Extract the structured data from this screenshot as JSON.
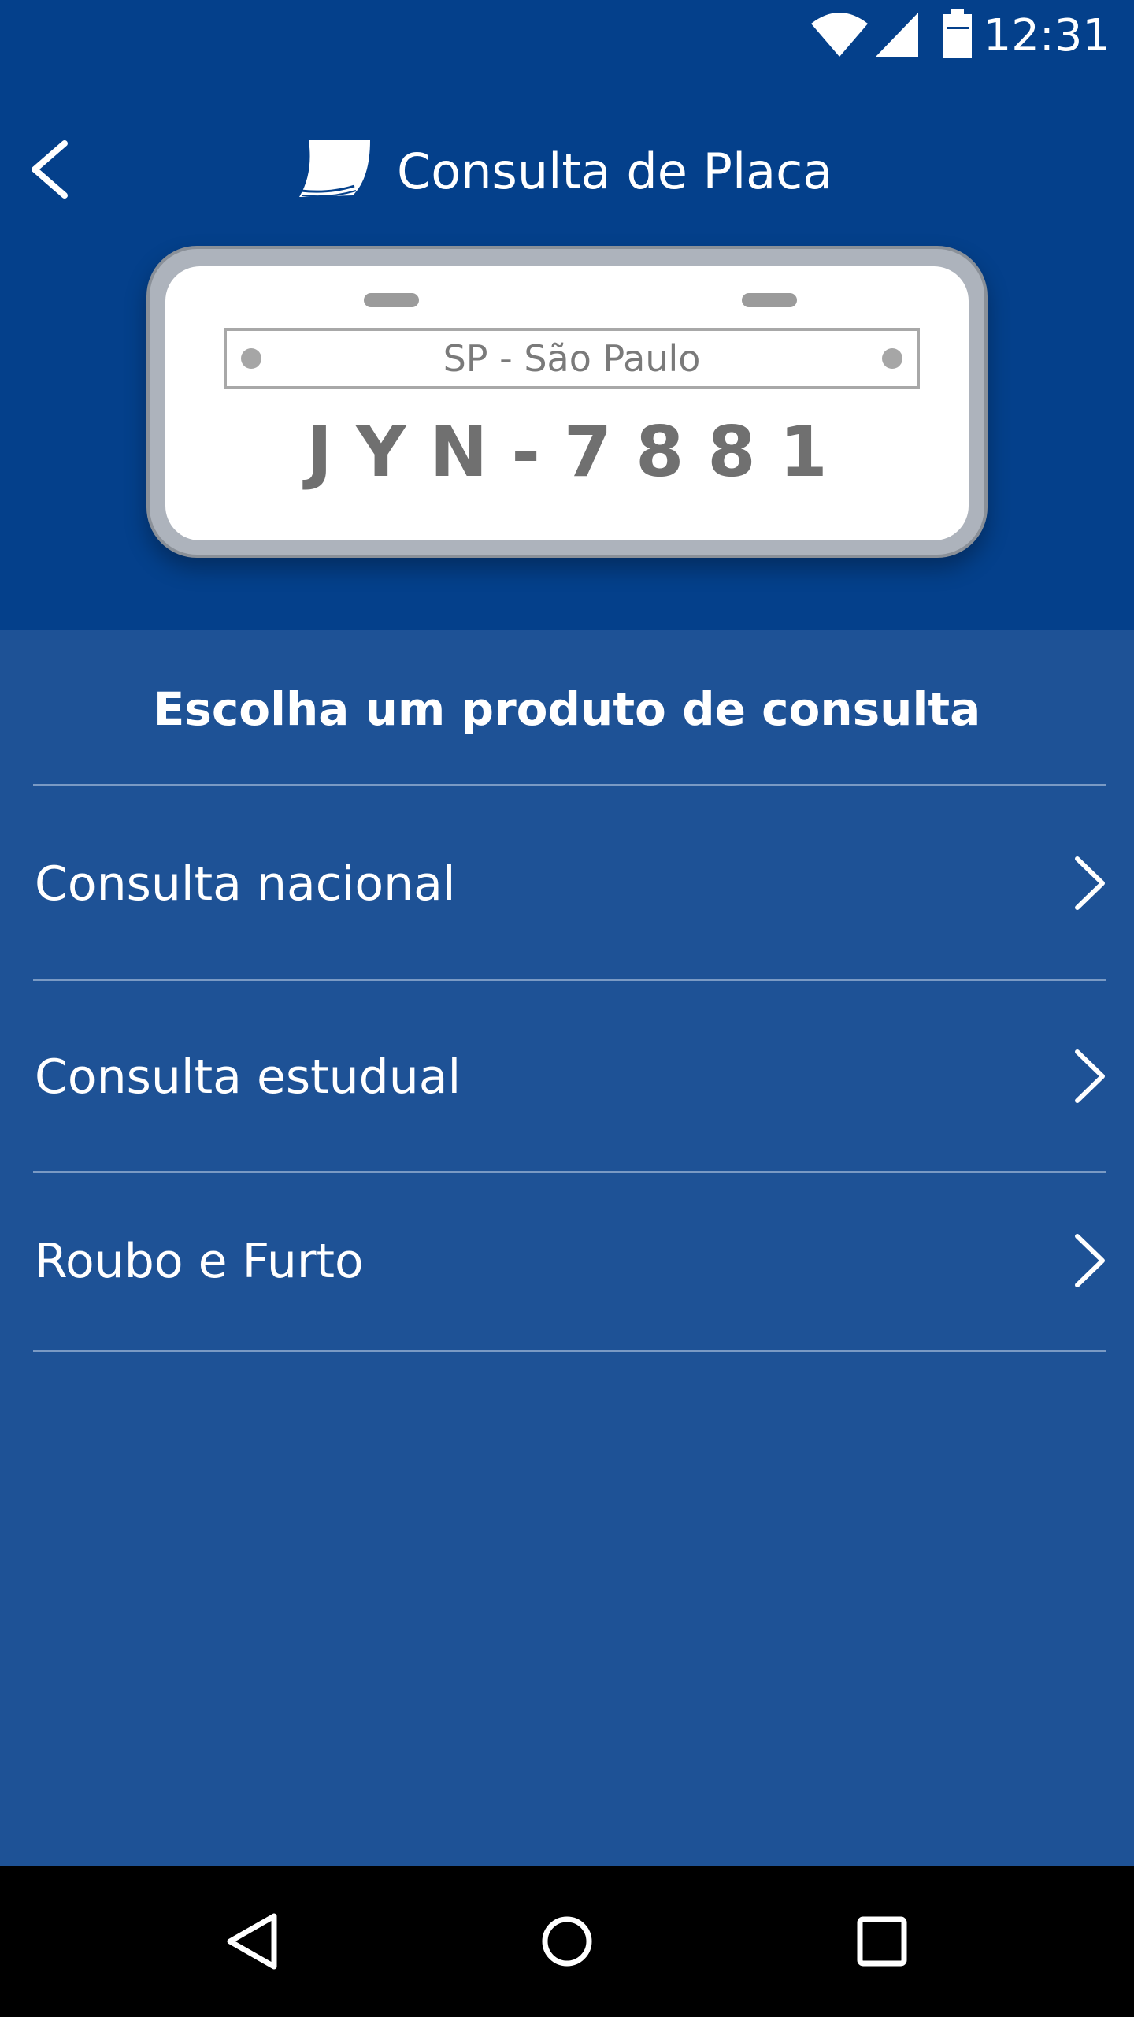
{
  "status_bar": {
    "time": "12:31",
    "icons": [
      "wifi-icon",
      "cell-signal-icon",
      "battery-icon"
    ]
  },
  "toolbar": {
    "back_icon": "back-arrow-icon",
    "logo_icon": "app-logo-icon",
    "title": "Consulta de Placa"
  },
  "plate": {
    "state": "SP - São Paulo",
    "number": "JYN-7881"
  },
  "products": {
    "title": "Escolha um produto de consulta",
    "items": [
      {
        "label": "Consulta nacional",
        "icon": "chevron-right-icon"
      },
      {
        "label": "Consulta estudual",
        "icon": "chevron-right-icon"
      },
      {
        "label": "Roubo e Furto",
        "icon": "chevron-right-icon"
      }
    ]
  },
  "nav_bar": {
    "icons": [
      "back-triangle-icon",
      "home-circle-icon",
      "recents-square-icon"
    ]
  },
  "colors": {
    "header_bg": "#04408b",
    "content_bg": "#1e5296",
    "divider": "#7a9ac4",
    "plate_frame": "#adb3bc",
    "plate_text": "#707070"
  }
}
